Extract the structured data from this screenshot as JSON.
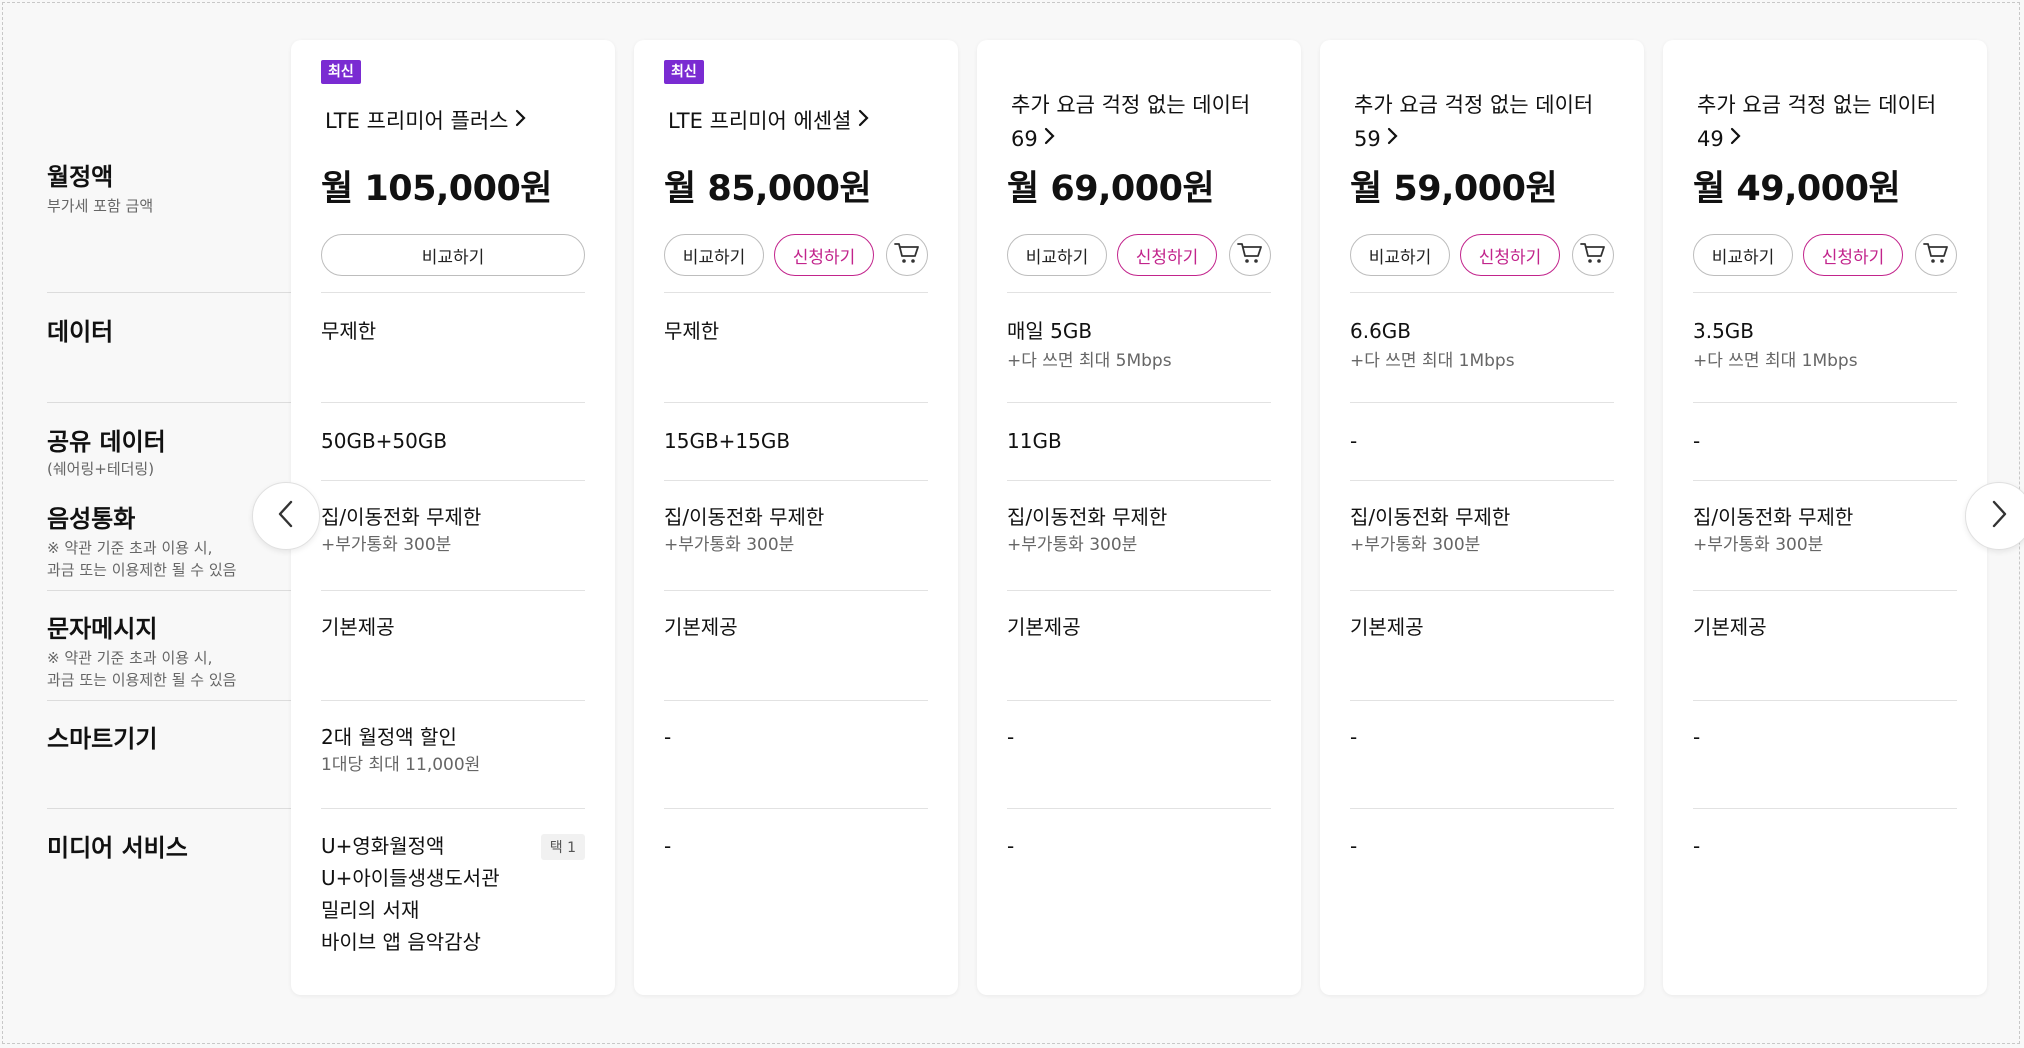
{
  "row_labels": {
    "price": {
      "title": "월정액",
      "sub": [
        "부가세 포함 금액"
      ]
    },
    "data": {
      "title": "데이터",
      "sub": []
    },
    "shared": {
      "title": "공유 데이터",
      "sub": [
        "(쉐어링+테더링)"
      ]
    },
    "voice": {
      "title": "음성통화",
      "sub": [
        "※ 약관 기준 초과 이용 시,",
        "과금 또는 이용제한 될 수 있음"
      ]
    },
    "sms": {
      "title": "문자메시지",
      "sub": [
        "※ 약관 기준 초과 이용 시,",
        "과금 또는 이용제한 될 수 있음"
      ]
    },
    "smart": {
      "title": "스마트기기",
      "sub": []
    },
    "media": {
      "title": "미디어 서비스",
      "sub": []
    }
  },
  "buttons": {
    "compare": "비교하기",
    "apply": "신청하기"
  },
  "plans": [
    {
      "badge": "최신",
      "name_lines": [
        "LTE 프리미어 플러스"
      ],
      "price": "월 105,000원",
      "data_main": "무제한",
      "data_sub": "",
      "shared": "50GB+50GB",
      "voice_main": "집/이동전화 무제한",
      "voice_sub": "+부가통화 300분",
      "sms": "기본제공",
      "smart_main": "2대 월정액 할인",
      "smart_sub": "1대당 최대 11,000원",
      "media": [
        "U+영화월정액",
        "U+아이들생생도서관",
        "밀리의 서재",
        "바이브 앱 음악감상"
      ],
      "media_tag": "택 1"
    },
    {
      "badge": "최신",
      "name_lines": [
        "LTE 프리미어 에센셜"
      ],
      "price": "월 85,000원",
      "data_main": "무제한",
      "data_sub": "",
      "shared": "15GB+15GB",
      "voice_main": "집/이동전화 무제한",
      "voice_sub": "+부가통화 300분",
      "sms": "기본제공",
      "smart_main": "-",
      "smart_sub": "",
      "media": [
        "-"
      ],
      "media_tag": ""
    },
    {
      "badge": "",
      "name_lines": [
        "추가 요금 걱정 없는 데이터",
        "69"
      ],
      "price": "월 69,000원",
      "data_main": "매일 5GB",
      "data_sub": "+다 쓰면 최대 5Mbps",
      "shared": "11GB",
      "voice_main": "집/이동전화 무제한",
      "voice_sub": "+부가통화 300분",
      "sms": "기본제공",
      "smart_main": "-",
      "smart_sub": "",
      "media": [
        "-"
      ],
      "media_tag": ""
    },
    {
      "badge": "",
      "name_lines": [
        "추가 요금 걱정 없는 데이터",
        "59"
      ],
      "price": "월 59,000원",
      "data_main": "6.6GB",
      "data_sub": "+다 쓰면 최대 1Mbps",
      "shared": "-",
      "voice_main": "집/이동전화 무제한",
      "voice_sub": "+부가통화 300분",
      "sms": "기본제공",
      "smart_main": "-",
      "smart_sub": "",
      "media": [
        "-"
      ],
      "media_tag": ""
    },
    {
      "badge": "",
      "name_lines": [
        "추가 요금 걱정 없는 데이터",
        "49"
      ],
      "price": "월 49,000원",
      "data_main": "3.5GB",
      "data_sub": "+다 쓰면 최대 1Mbps",
      "shared": "-",
      "voice_main": "집/이동전화 무제한",
      "voice_sub": "+부가통화 300분",
      "sms": "기본제공",
      "smart_main": "-",
      "smart_sub": "",
      "media": [
        "-"
      ],
      "media_tag": ""
    }
  ],
  "colors": {
    "badge": "#7a2bd2",
    "apply": "#c2248c"
  },
  "icons": {
    "prev": "chevron-left-icon",
    "next": "chevron-right-icon",
    "cart": "cart-icon",
    "plan_link": "chevron-right-icon"
  }
}
